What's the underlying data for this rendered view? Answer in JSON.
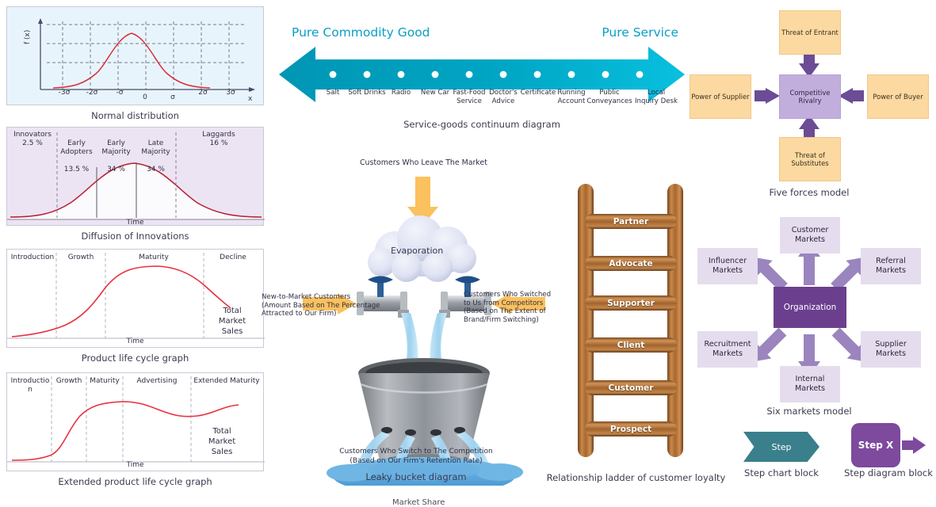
{
  "charts": {
    "normal": {
      "caption": "Normal distribution",
      "ylabel": "f (x)",
      "xlabel": "x",
      "ticks": [
        "-3σ",
        "-2σ",
        "-σ",
        "0",
        "σ",
        "2σ",
        "3σ"
      ]
    },
    "diffusion": {
      "caption": "Diffusion of Innovations",
      "xlabel": "Time",
      "segments": [
        {
          "name": "Innovators",
          "pct": "2.5 %"
        },
        {
          "name": "Early\nAdopters",
          "pct": "13.5 %"
        },
        {
          "name": "Early\nMajority",
          "pct": "34 %"
        },
        {
          "name": "Late\nMajority",
          "pct": "34 %"
        },
        {
          "name": "Laggards",
          "pct": "16 %"
        }
      ]
    },
    "plc": {
      "caption": "Product life cycle graph",
      "xlabel": "Time",
      "stages": [
        "Introduction",
        "Growth",
        "Maturity",
        "Decline"
      ],
      "series_label": "Total\nMarket\nSales"
    },
    "eplc": {
      "caption": "Extended product life cycle graph",
      "xlabel": "Time",
      "stages": [
        "Introductio\nn",
        "Growth",
        "Maturity",
        "Advertising",
        "Extended Maturity"
      ],
      "series_label": "Total\nMarket\nSales"
    }
  },
  "continuum": {
    "caption": "Service-goods continuum diagram",
    "left_title": "Pure Commodity Good",
    "right_title": "Pure Service",
    "items": [
      "Salt",
      "Soft Drinks",
      "Radio",
      "New Car",
      "Fast-Food\nService",
      "Doctor's\nAdvice",
      "Certificate",
      "Running\nAccount",
      "Public\nConveyances",
      "Local\nInquiry Desk"
    ],
    "accent": "#00a0bd"
  },
  "leaky_bucket": {
    "caption": "Leaky bucket diagram",
    "top_arrow_label": "Customers Who Leave The Market",
    "cloud_label": "Evaporation",
    "bucket_label": "Market Share",
    "left_label": "New-to-Market Customers\n(Amount Based on The Percentage\nAttracted to Our Firm)",
    "right_label": "Customers Who Switched\nto Us from Competitors\n(Based on The Extent of\nBrand/Firm Switching)",
    "bottom_label": "Customers Who Switch to The Competition\n(Based on Our Firm's Retention Rate)"
  },
  "ladder": {
    "caption": "Relationship ladder of customer loyalty",
    "rungs": [
      "Partner",
      "Advocate",
      "Supporter",
      "Client",
      "Customer",
      "Prospect"
    ]
  },
  "five_forces": {
    "caption": "Five forces model",
    "center": "Competitive Rivalry",
    "top": "Threat of Entrant",
    "left": "Power of Supplier",
    "right": "Power of Buyer",
    "bottom": "Threat of\nSubstitutes",
    "box_color": "#fcd9a0",
    "center_color": "#c2aedd",
    "arrow_color": "#6b4c95"
  },
  "six_markets": {
    "caption": "Six markets model",
    "center": "Organization",
    "top": "Customer\nMarkets",
    "top_left": "Influencer\nMarkets",
    "top_right": "Referral\nMarkets",
    "bottom_left": "Recruitment\nMarkets",
    "bottom_right": "Supplier\nMarkets",
    "bottom": "Internal\nMarkets",
    "box_color": "#e5dcee",
    "center_color": "#6b3f8e",
    "arrow_color": "#9a85be"
  },
  "step_blocks": {
    "chart": {
      "label": "Step",
      "caption": "Step chart block",
      "color": "#3a7f8c"
    },
    "diagram": {
      "label": "Step X",
      "caption": "Step diagram block",
      "color": "#7d4a9e"
    }
  },
  "chart_data": [
    {
      "type": "line",
      "title": "Normal distribution",
      "xlabel": "x",
      "ylabel": "f (x)",
      "x": [
        -3.5,
        -3,
        -2.5,
        -2,
        -1.5,
        -1,
        -0.5,
        0,
        0.5,
        1,
        1.5,
        2,
        2.5,
        3,
        3.5
      ],
      "values": [
        0.009,
        0.044,
        0.13,
        0.27,
        0.46,
        0.66,
        0.88,
        1.0,
        0.88,
        0.66,
        0.46,
        0.27,
        0.13,
        0.044,
        0.009
      ],
      "xticks": [
        "-3σ",
        "-2σ",
        "-σ",
        "0",
        "σ",
        "2σ",
        "3σ"
      ],
      "grid": true,
      "legend": "none"
    },
    {
      "type": "area",
      "title": "Diffusion of Innovations",
      "xlabel": "Time",
      "ylabel": "",
      "categories": [
        "Innovators",
        "Early Adopters",
        "Early Majority",
        "Late Majority",
        "Laggards"
      ],
      "values": [
        2.5,
        13.5,
        34,
        34,
        16
      ],
      "value_unit": "%",
      "grid": false,
      "legend": "none"
    },
    {
      "type": "line",
      "title": "Product life cycle graph",
      "xlabel": "Time",
      "ylabel": "",
      "series": [
        {
          "name": "Total Market Sales",
          "values": [
            2,
            6,
            16,
            38,
            62,
            76,
            80,
            80,
            76,
            66,
            52
          ]
        }
      ],
      "stages": [
        "Introduction",
        "Growth",
        "Maturity",
        "Decline"
      ],
      "grid": false,
      "legend": "inline-right"
    },
    {
      "type": "line",
      "title": "Extended product life cycle graph",
      "xlabel": "Time",
      "ylabel": "",
      "series": [
        {
          "name": "Total Market Sales",
          "values": [
            3,
            4,
            8,
            26,
            54,
            70,
            76,
            77,
            72,
            64,
            60,
            58,
            62,
            68,
            70
          ]
        }
      ],
      "stages": [
        "Introduction",
        "Growth",
        "Maturity",
        "Advertising",
        "Extended Maturity"
      ],
      "grid": false,
      "legend": "inline-right"
    }
  ]
}
